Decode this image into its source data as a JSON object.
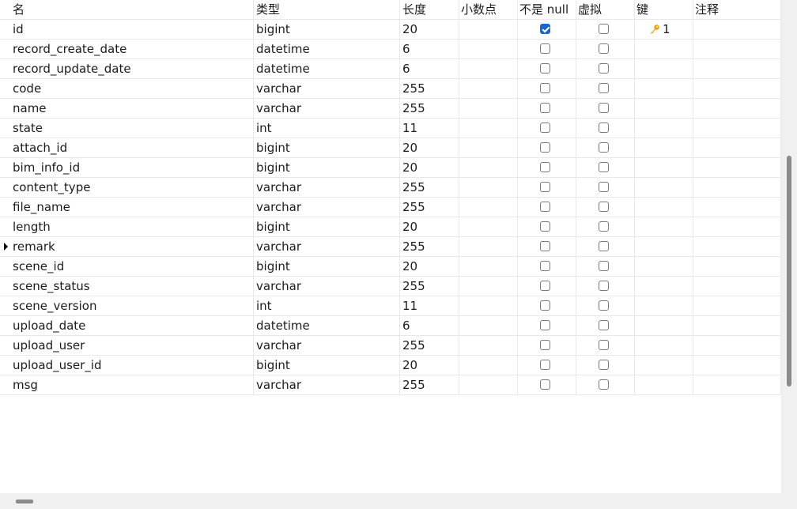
{
  "columns": {
    "name": "名",
    "type": "类型",
    "length": "长度",
    "decimal": "小数点",
    "not_null": "不是 null",
    "virtual": "虚拟",
    "key": "键",
    "comment": "注释"
  },
  "rows": [
    {
      "name": "id",
      "type": "bigint",
      "length": "20",
      "not_null": true,
      "virtual": false,
      "key": "1"
    },
    {
      "name": "record_create_date",
      "type": "datetime",
      "length": "6",
      "not_null": false,
      "virtual": false,
      "key": ""
    },
    {
      "name": "record_update_date",
      "type": "datetime",
      "length": "6",
      "not_null": false,
      "virtual": false,
      "key": ""
    },
    {
      "name": "code",
      "type": "varchar",
      "length": "255",
      "not_null": false,
      "virtual": false,
      "key": ""
    },
    {
      "name": "name",
      "type": "varchar",
      "length": "255",
      "not_null": false,
      "virtual": false,
      "key": ""
    },
    {
      "name": "state",
      "type": "int",
      "length": "11",
      "not_null": false,
      "virtual": false,
      "key": ""
    },
    {
      "name": "attach_id",
      "type": "bigint",
      "length": "20",
      "not_null": false,
      "virtual": false,
      "key": ""
    },
    {
      "name": "bim_info_id",
      "type": "bigint",
      "length": "20",
      "not_null": false,
      "virtual": false,
      "key": ""
    },
    {
      "name": "content_type",
      "type": "varchar",
      "length": "255",
      "not_null": false,
      "virtual": false,
      "key": ""
    },
    {
      "name": "file_name",
      "type": "varchar",
      "length": "255",
      "not_null": false,
      "virtual": false,
      "key": ""
    },
    {
      "name": "length",
      "type": "bigint",
      "length": "20",
      "not_null": false,
      "virtual": false,
      "key": ""
    },
    {
      "name": "remark",
      "type": "varchar",
      "length": "255",
      "not_null": false,
      "virtual": false,
      "key": "",
      "current": true
    },
    {
      "name": "scene_id",
      "type": "bigint",
      "length": "20",
      "not_null": false,
      "virtual": false,
      "key": ""
    },
    {
      "name": "scene_status",
      "type": "varchar",
      "length": "255",
      "not_null": false,
      "virtual": false,
      "key": ""
    },
    {
      "name": "scene_version",
      "type": "int",
      "length": "11",
      "not_null": false,
      "virtual": false,
      "key": ""
    },
    {
      "name": "upload_date",
      "type": "datetime",
      "length": "6",
      "not_null": false,
      "virtual": false,
      "key": ""
    },
    {
      "name": "upload_user",
      "type": "varchar",
      "length": "255",
      "not_null": false,
      "virtual": false,
      "key": ""
    },
    {
      "name": "upload_user_id",
      "type": "bigint",
      "length": "20",
      "not_null": false,
      "virtual": false,
      "key": ""
    },
    {
      "name": "msg",
      "type": "varchar",
      "length": "255",
      "not_null": false,
      "virtual": false,
      "key": ""
    }
  ],
  "colors": {
    "checkbox_checked": "#1a66c8",
    "key_icon": "#e8a317"
  },
  "icons": {
    "key": "key-icon",
    "row_pointer": "row-pointer-icon"
  }
}
